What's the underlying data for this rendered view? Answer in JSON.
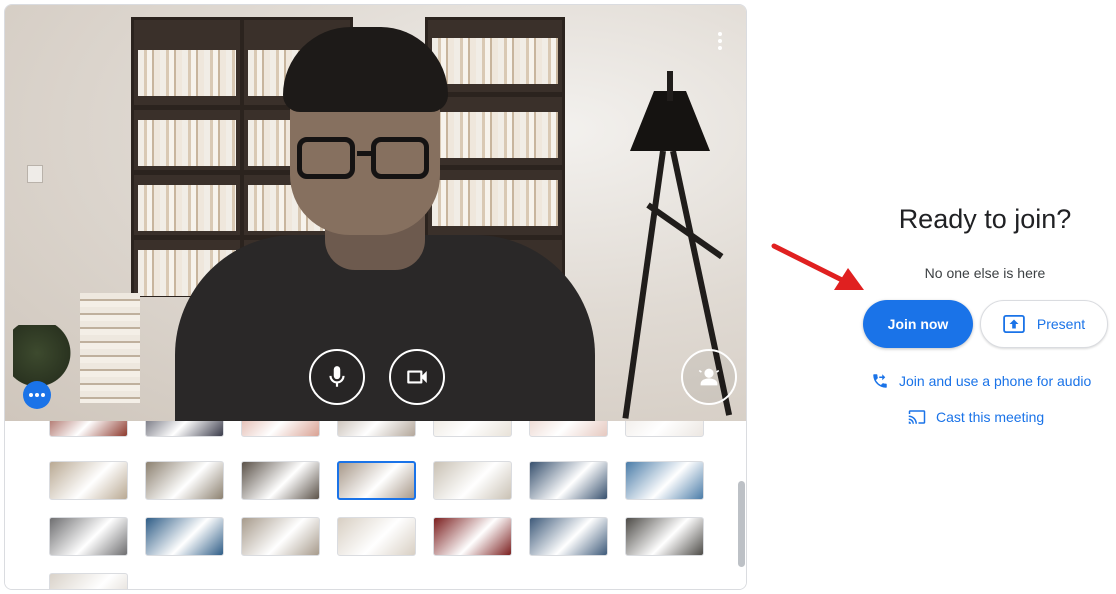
{
  "join_panel": {
    "title": "Ready to join?",
    "subtitle": "No one else is here",
    "join_now_label": "Join now",
    "present_label": "Present",
    "phone_audio_label": "Join and use a phone for audio",
    "cast_label": "Cast this meeting"
  },
  "video_preview": {
    "controls": [
      {
        "name": "microphone-button",
        "icon": "microphone-icon"
      },
      {
        "name": "camera-button",
        "icon": "camera-icon"
      },
      {
        "name": "background-effects-button",
        "icon": "person-background-icon"
      }
    ],
    "menu_icon": "more-vert-icon",
    "effects_badge_icon": "more-horiz-icon"
  },
  "backgrounds": {
    "selected_index": 10,
    "thumbnails": [
      {
        "label": "red-abstract",
        "color": "#8e3a2e"
      },
      {
        "label": "night-scene",
        "color": "#3a3b4a"
      },
      {
        "label": "red-flowers-white",
        "color": "#d9a294"
      },
      {
        "label": "textured-grey",
        "color": "#b3a79b"
      },
      {
        "label": "light-sand",
        "color": "#e8e2d8"
      },
      {
        "label": "pink-pattern",
        "color": "#e6c9c0"
      },
      {
        "label": "white-floral",
        "color": "#ece7e2"
      },
      {
        "label": "office-wall",
        "color": "#b9a993"
      },
      {
        "label": "sunlit-room",
        "color": "#8c8170"
      },
      {
        "label": "loft-interior",
        "color": "#5b5249"
      },
      {
        "label": "bookshelf-blur",
        "color": "#a8998a"
      },
      {
        "label": "shelf-decor",
        "color": "#c9c1b4"
      },
      {
        "label": "blue-sky-building",
        "color": "#37506e"
      },
      {
        "label": "seaside",
        "color": "#4a7ca8"
      },
      {
        "label": "mountain-snow",
        "color": "#6e6e70"
      },
      {
        "label": "blue-beach",
        "color": "#2f5d87"
      },
      {
        "label": "horses-field",
        "color": "#a79b8c"
      },
      {
        "label": "bright-room",
        "color": "#d8cfc3"
      },
      {
        "label": "red-flowers-dark",
        "color": "#7b1f1f"
      },
      {
        "label": "fern-blue",
        "color": "#3e5a7a"
      },
      {
        "label": "dark-stone",
        "color": "#4d4b47"
      },
      {
        "label": "floral-cream",
        "color": "#d9d2c9"
      }
    ]
  },
  "colors": {
    "accent": "#1a73e8",
    "arrow": "#e02020"
  }
}
